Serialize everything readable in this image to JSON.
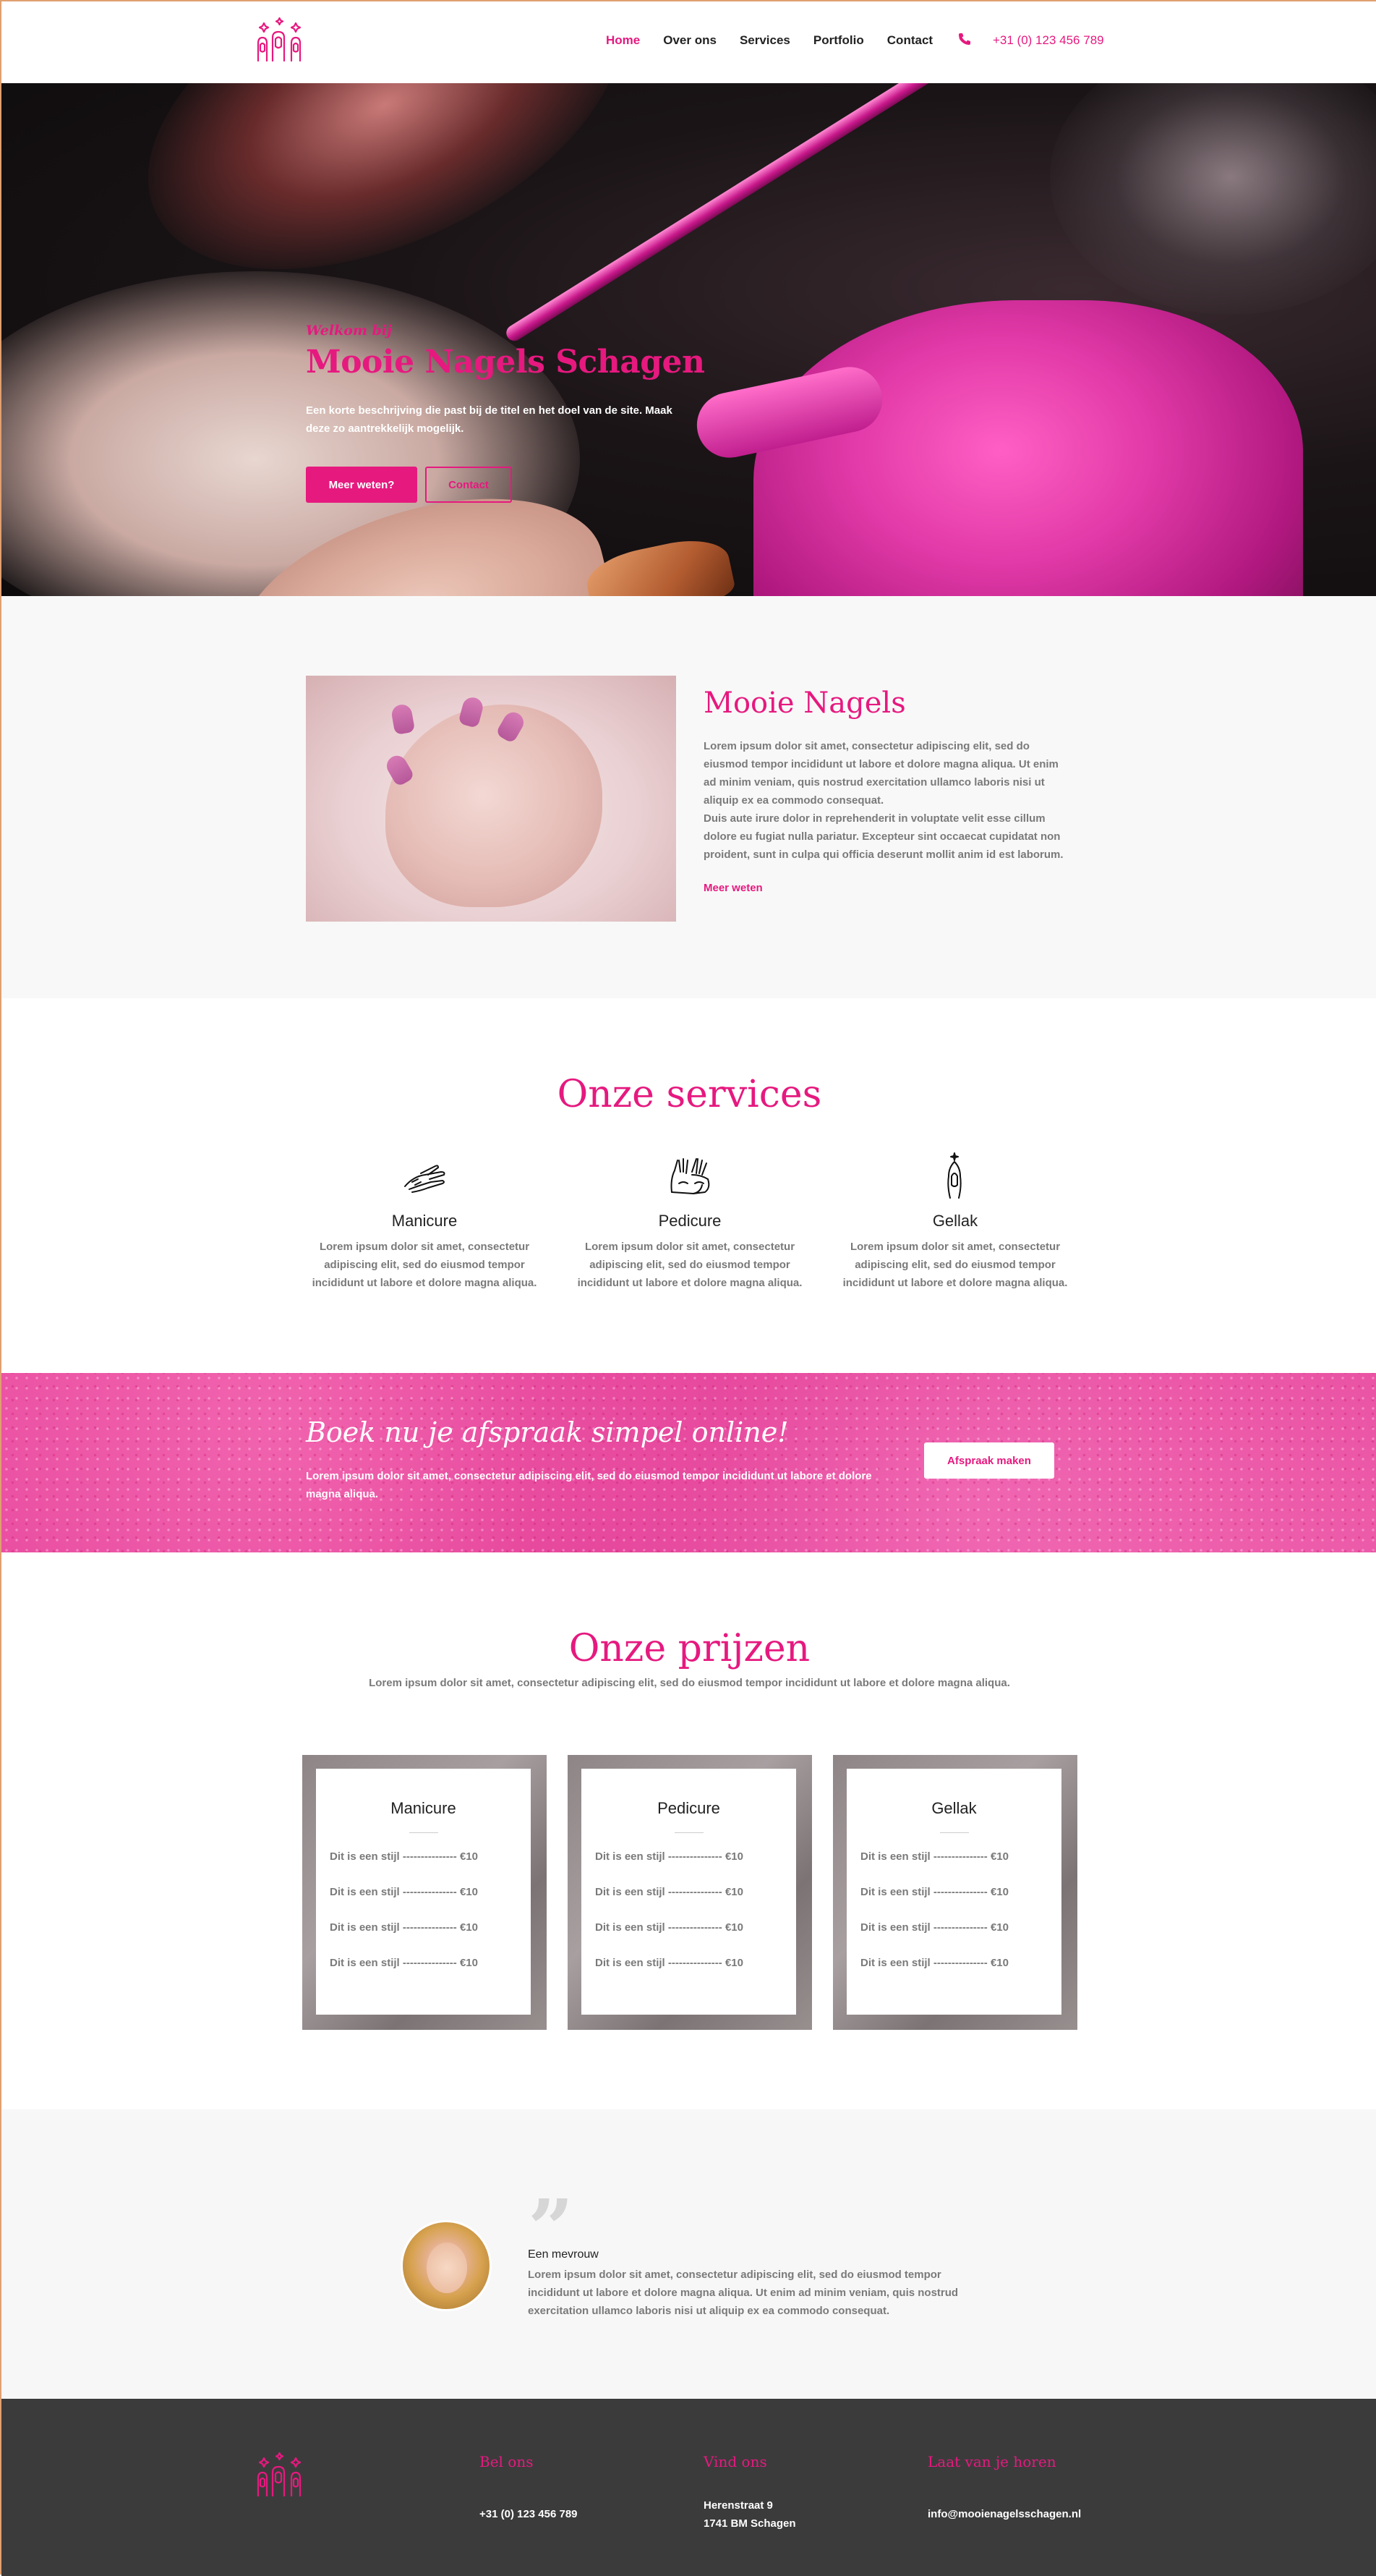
{
  "nav": {
    "items": [
      "Home",
      "Over ons",
      "Services",
      "Portfolio",
      "Contact"
    ],
    "phone": "+31 (0) 123 456 789"
  },
  "hero": {
    "kicker": "Welkom bij",
    "title": "Mooie Nagels Schagen",
    "text": "Een korte beschrijving die past bij de titel en het doel van de site. Maak deze zo aantrekkelijk mogelijk.",
    "btn_primary": "Meer weten?",
    "btn_secondary": "Contact"
  },
  "about": {
    "title": "Mooie Nagels",
    "text": "Lorem ipsum dolor sit amet, consectetur adipiscing elit, sed do eiusmod tempor incididunt ut labore et dolore magna aliqua. Ut enim ad minim veniam, quis nostrud exercitation ullamco laboris nisi ut aliquip ex ea commodo consequat.",
    "text2": "Duis aute irure dolor in reprehenderit in voluptate velit esse cillum dolore eu fugiat nulla pariatur. Excepteur sint occaecat cupidatat non proident, sunt in culpa qui officia deserunt mollit anim id est laborum.",
    "link": "Meer weten"
  },
  "services": {
    "title": "Onze services",
    "items": [
      {
        "name": "Manicure",
        "text": "Lorem ipsum dolor sit amet, consectetur adipiscing elit, sed do eiusmod tempor incididunt ut labore et dolore magna aliqua.",
        "icon": "manicure-icon"
      },
      {
        "name": "Pedicure",
        "text": "Lorem ipsum dolor sit amet, consectetur adipiscing elit, sed do eiusmod tempor incididunt ut labore et dolore magna aliqua.",
        "icon": "pedicure-icon"
      },
      {
        "name": "Gellak",
        "text": "Lorem ipsum dolor sit amet, consectetur adipiscing elit, sed do eiusmod tempor incididunt ut labore et dolore magna aliqua.",
        "icon": "gellak-icon"
      }
    ]
  },
  "cta": {
    "title": "Boek nu je afspraak simpel online!",
    "text": "Lorem ipsum dolor sit amet, consectetur adipiscing elit, sed do eiusmod tempor incididunt ut labore et dolore magna aliqua.",
    "button": "Afspraak maken"
  },
  "prices": {
    "title": "Onze prijzen",
    "subtitle": "Lorem ipsum dolor sit amet, consectetur adipiscing elit, sed do eiusmod tempor incididunt ut labore et dolore magna aliqua.",
    "cards": [
      {
        "name": "Manicure",
        "rows": [
          "Dit is een stijl --------------- €10",
          "Dit is een stijl --------------- €10",
          "Dit is een stijl --------------- €10",
          "Dit is een stijl --------------- €10"
        ]
      },
      {
        "name": "Pedicure",
        "rows": [
          "Dit is een stijl --------------- €10",
          "Dit is een stijl --------------- €10",
          "Dit is een stijl --------------- €10",
          "Dit is een stijl --------------- €10"
        ]
      },
      {
        "name": "Gellak",
        "rows": [
          "Dit is een stijl --------------- €10",
          "Dit is een stijl --------------- €10",
          "Dit is een stijl --------------- €10",
          "Dit is een stijl --------------- €10"
        ]
      }
    ]
  },
  "testimonial": {
    "quote_mark": "”",
    "name": "Een mevrouw",
    "text": "Lorem ipsum dolor sit amet, consectetur adipiscing elit, sed do eiusmod tempor incididunt ut labore et dolore magna aliqua. Ut enim ad minim veniam, quis nostrud exercitation ullamco laboris nisi ut aliquip ex ea commodo consequat."
  },
  "footer": {
    "call": {
      "title": "Bel ons",
      "value": "+31 (0) 123 456 789"
    },
    "find": {
      "title": "Vind ons",
      "line1": "Herenstraat 9",
      "line2": "1741 BM Schagen"
    },
    "mail": {
      "title": "Laat van je horen",
      "value": "info@mooienagelsschagen.nl"
    }
  },
  "colors": {
    "accent": "#e6197f",
    "footer_bg": "#3c3b3c"
  }
}
